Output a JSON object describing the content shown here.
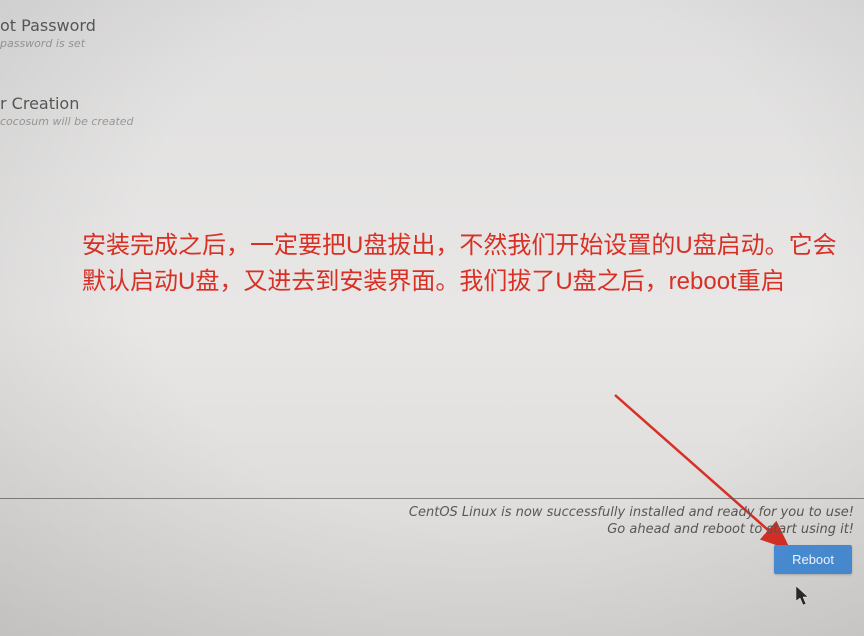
{
  "settings": {
    "root_password": {
      "title_fragment": "ot Password",
      "subtitle": "password is set"
    },
    "user_creation": {
      "title": "r Creation",
      "subtitle": "cocosum will be created"
    }
  },
  "overlay_note": "安装完成之后，一定要把U盘拔出，不然我们开始设置的U盘启动。它会默认启动U盘，又进去到安装界面。我们拔了U盘之后，reboot重启",
  "status": {
    "line1": "CentOS Linux is now successfully installed and ready for you to use!",
    "line2": "Go ahead and reboot to start using it!"
  },
  "reboot_button": "Reboot"
}
